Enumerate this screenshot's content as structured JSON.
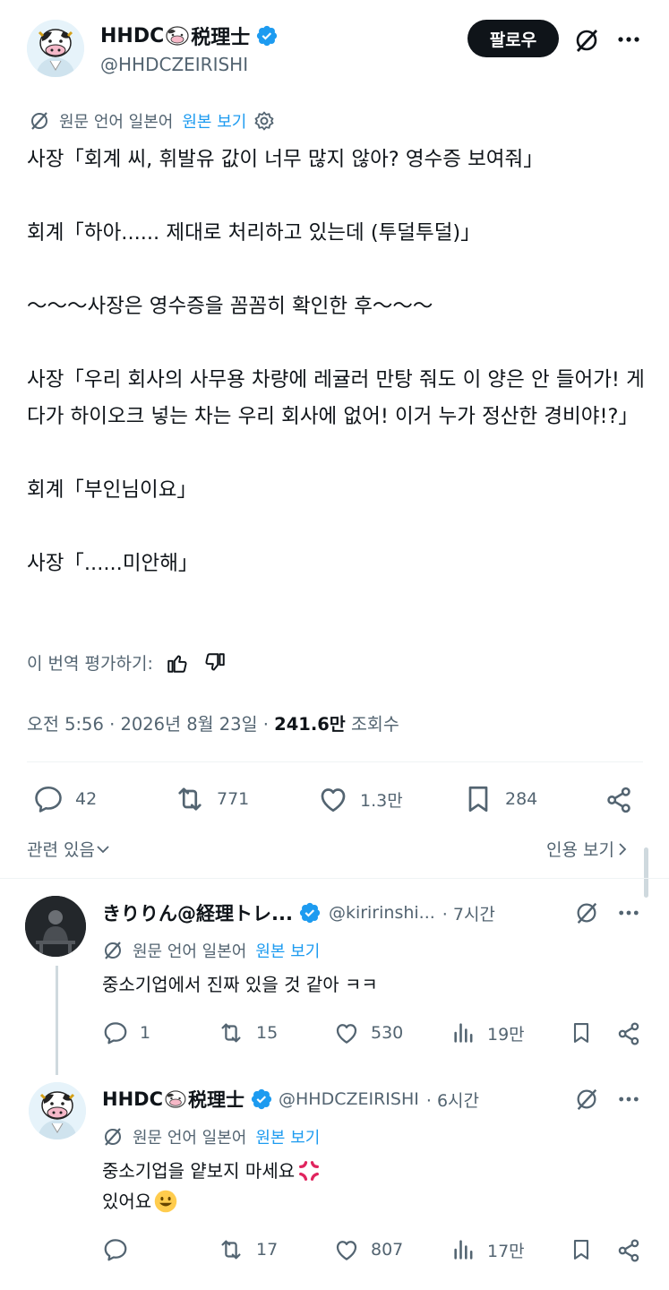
{
  "colors": {
    "accent": "#1d9bf0",
    "text": "#0f1419",
    "muted": "#536471",
    "follow_bg": "#0f1419",
    "anger": "#e0245e",
    "emoji": "#ffcc4d"
  },
  "main_tweet": {
    "author_name": "HHDC🐮税理士",
    "author_name_prefix": "HHDC",
    "author_name_suffix": "税理士",
    "author_handle": "@HHDCZEIRISHI",
    "follow_label": "팔로우",
    "translation": {
      "label": "원문 언어 일본어",
      "link": "원본 보기"
    },
    "body": [
      "사장「회계 씨, 휘발유 값이 너무 많지 않아? 영수증 보여줘」",
      "회계「하아...... 제대로 처리하고 있는데 (투덜투덜)」",
      "〜〜〜사장은 영수증을 꼼꼼히 확인한 후〜〜〜",
      "사장「우리 회사의 사무용 차량에 레귤러 만탕 줘도 이 양은 안 들어가! 게다가 하이오크 넣는 차는 우리 회사에 없어! 이거 누가 정산한 경비야!?」",
      "회계「부인님이요」",
      "사장「......미안해」"
    ],
    "rate_label": "이 번역 평가하기:",
    "timestamp": "오전 5:56 · 2026년 8월 23일 · ",
    "views_count": "241.6만",
    "views_label": " 조회수",
    "actions": {
      "replies": "42",
      "retweets": "771",
      "likes": "1.3만",
      "bookmarks": "284"
    },
    "related_label": "관련 있음",
    "quotes_label": "인용 보기"
  },
  "replies": [
    {
      "author_name": "きりりん@経理トレ...",
      "author_handle": "@kiririnshi...",
      "time": "· 7시간",
      "translation": {
        "label": "원문 언어 일본어",
        "link": "원본 보기"
      },
      "text": [
        "중소기업에서 진짜 있을 것 같아 ㅋㅋ"
      ],
      "actions": {
        "replies": "1",
        "retweets": "15",
        "likes": "530",
        "views": "19만"
      }
    },
    {
      "author_name_prefix": "HHDC",
      "author_name_suffix": "税理士",
      "author_handle": "@HHDCZEIRISHI",
      "time": "· 6시간",
      "translation": {
        "label": "원문 언어 일본어",
        "link": "원본 보기"
      },
      "text": [
        "중소기업을 얕보지 마세요",
        "있어요"
      ],
      "actions": {
        "replies": "",
        "retweets": "17",
        "likes": "807",
        "views": "17만"
      }
    }
  ]
}
